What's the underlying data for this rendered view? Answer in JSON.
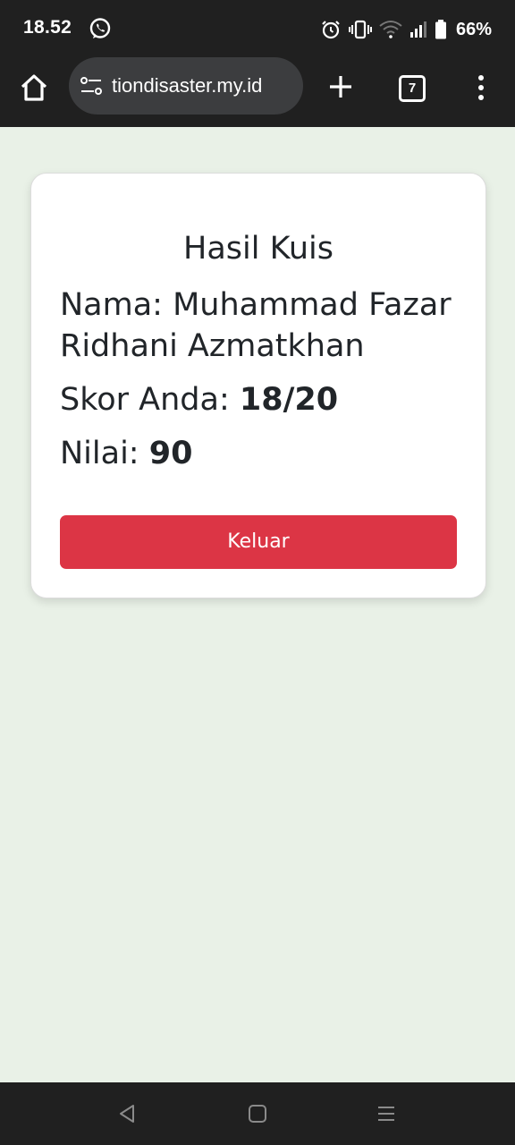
{
  "status_bar": {
    "time": "18.52",
    "battery_percent": "66%",
    "icons": [
      "whatsapp-icon",
      "alarm-icon",
      "vibrate-icon",
      "wifi-icon",
      "signal-icon",
      "battery-icon"
    ]
  },
  "browser": {
    "url": "tiondisaster.my.id",
    "tab_count": "7",
    "icons": [
      "home-icon",
      "site-settings-icon",
      "plus-icon",
      "tabs-icon",
      "more-vert-icon"
    ]
  },
  "quiz_result": {
    "title": "Hasil Kuis",
    "name_label": "Nama:",
    "name_value": "Muhammad Fazar Ridhani Azmatkhan",
    "score_label": "Skor Anda:",
    "score_value": "18/20",
    "grade_label": "Nilai:",
    "grade_value": "90",
    "logout_label": "Keluar"
  },
  "nav_bar": {
    "icons": [
      "back-icon",
      "home-square-icon",
      "recent-apps-icon"
    ]
  },
  "colors": {
    "page_background": "#e9f1e7",
    "button_red": "#dc3545",
    "system_bar": "#202020"
  }
}
